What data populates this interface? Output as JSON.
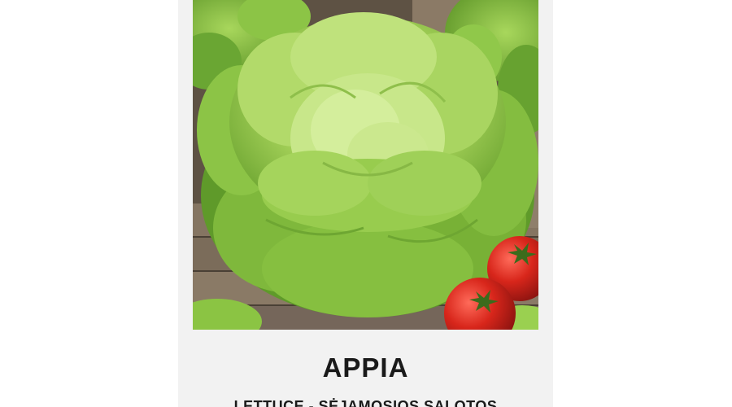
{
  "product": {
    "name": "APPIA",
    "subtitle": "LETTUCE - SĖJAMOSIOS SALOTOS"
  },
  "photo": {
    "subject": "butterhead-lettuce-with-tomatoes"
  },
  "colors": {
    "card_background": "#f2f2f2",
    "text": "#1a1a1a",
    "lettuce_light": "#b5dc6a",
    "lettuce_mid": "#8cc43e",
    "lettuce_dark": "#5f9a2a",
    "tomato": "#d42a1f",
    "wood": "#7a6a58"
  }
}
